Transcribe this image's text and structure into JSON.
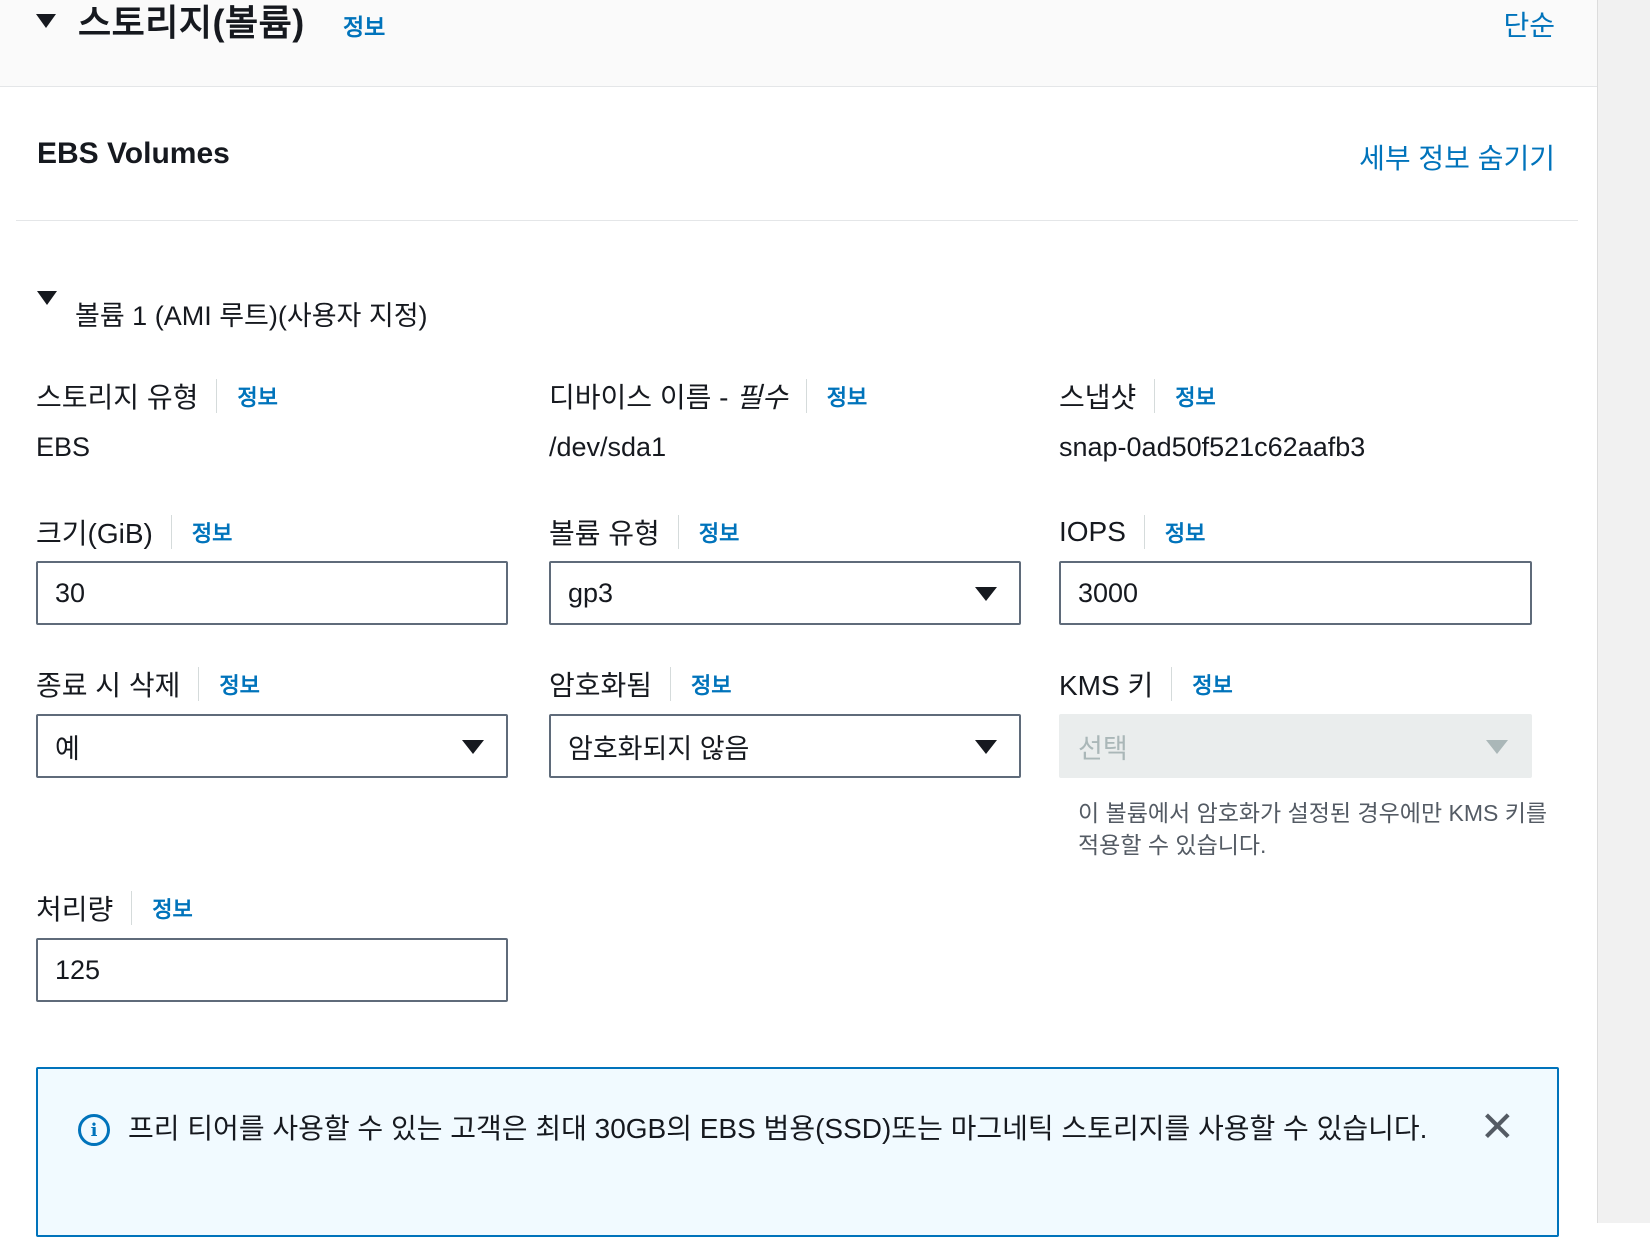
{
  "header": {
    "title": "스토리지(볼륨)",
    "info": "정보",
    "simple_link": "단순"
  },
  "ebs": {
    "title": "EBS Volumes",
    "hide_details": "세부 정보 숨기기"
  },
  "volume": {
    "title": "볼륨 1 (AMI 루트)(사용자 지정)"
  },
  "fields": {
    "storage_type": {
      "label": "스토리지 유형",
      "info": "정보",
      "value": "EBS"
    },
    "device_name": {
      "label": "디바이스 이름 - ",
      "required": "필수",
      "info": "정보",
      "value": "/dev/sda1"
    },
    "snapshot": {
      "label": "스냅샷",
      "info": "정보",
      "value": "snap-0ad50f521c62aafb3"
    },
    "size": {
      "label": "크기(GiB)",
      "info": "정보",
      "value": "30"
    },
    "volume_type": {
      "label": "볼륨 유형",
      "info": "정보",
      "value": "gp3"
    },
    "iops": {
      "label": "IOPS",
      "info": "정보",
      "value": "3000"
    },
    "delete_on_termination": {
      "label": "종료 시 삭제",
      "info": "정보",
      "value": "예"
    },
    "encrypted": {
      "label": "암호화됨",
      "info": "정보",
      "value": "암호화되지 않음"
    },
    "kms_key": {
      "label": "KMS 키",
      "info": "정보",
      "placeholder": "선택",
      "hint": "이 볼륨에서 암호화가 설정된 경우에만 KMS 키를 적용할 수 있습니다."
    },
    "throughput": {
      "label": "처리량",
      "info": "정보",
      "value": "125"
    }
  },
  "alert": {
    "icon": "info-icon",
    "text": "프리 티어를 사용할 수 있는 고객은 최대 30GB의 EBS 범용(SSD)또는 마그네틱 스토리지를 사용할 수 있습니다.",
    "close_symbol": "✕"
  },
  "colors": {
    "link": "#0073bb",
    "text": "#16191f",
    "border": "#5f6b7a",
    "alert_bg": "#f1faff"
  }
}
